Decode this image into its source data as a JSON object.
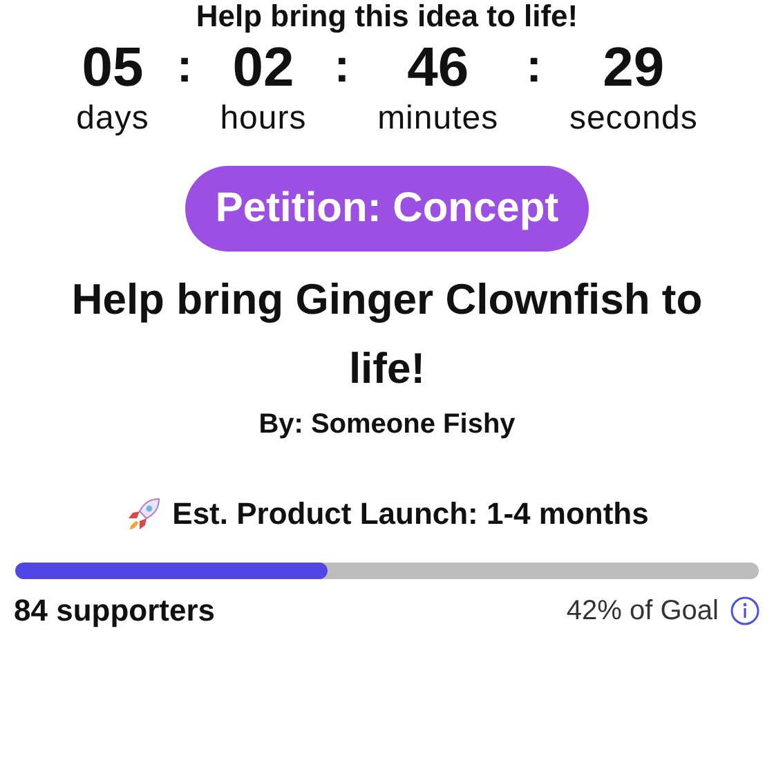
{
  "heading": "Help bring this idea to life!",
  "countdown": [
    {
      "value": "05",
      "unit": "days",
      "separator": ":"
    },
    {
      "value": "02",
      "unit": "hours",
      "separator": ":"
    },
    {
      "value": "46",
      "unit": "minutes",
      "separator": ":"
    },
    {
      "value": "29",
      "unit": "seconds"
    }
  ],
  "badge": "Petition: Concept",
  "title": "Help bring Ginger Clownfish to life!",
  "author": "By: Someone Fishy",
  "launch": "Est. Product Launch: 1-4 months",
  "progress": {
    "level": 0.42
  },
  "supporters": "84 supporters",
  "goal": "42% of Goal"
}
